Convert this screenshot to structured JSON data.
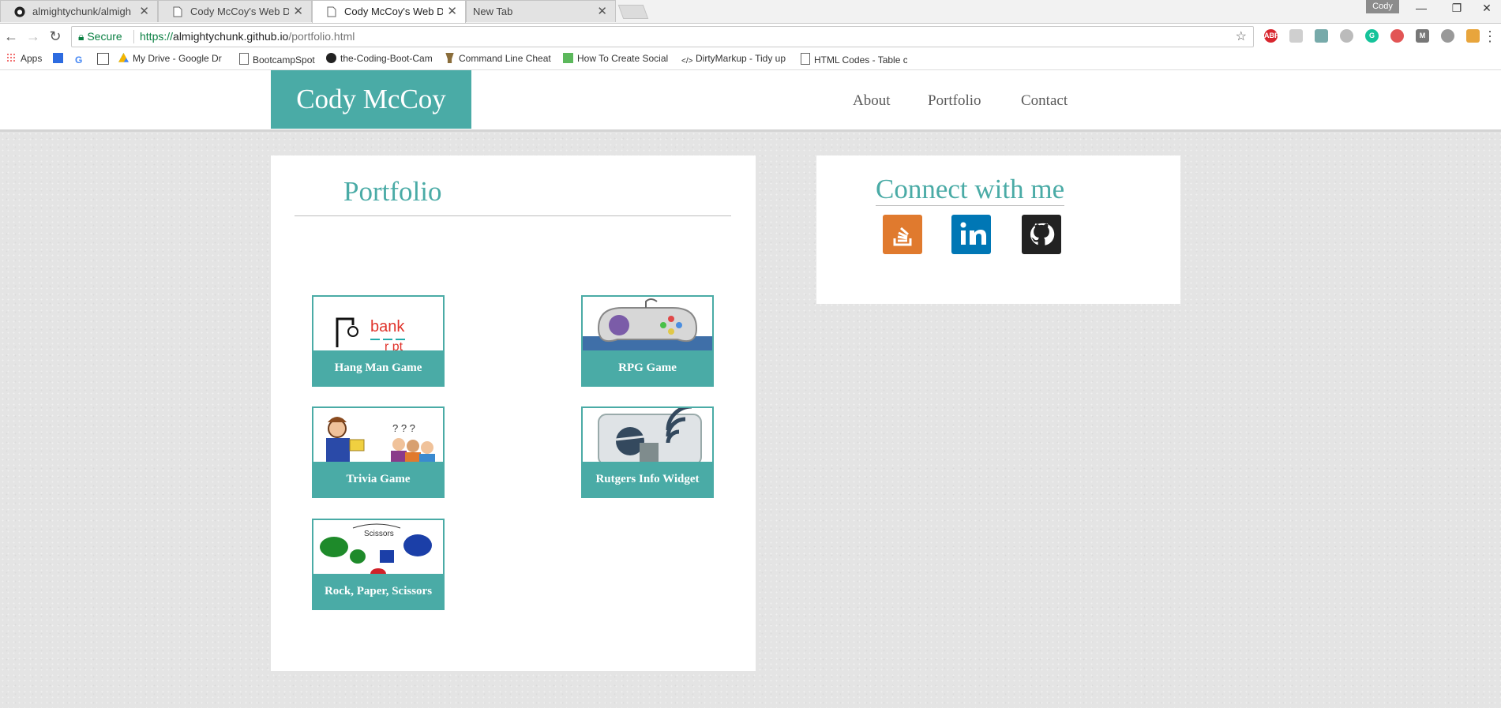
{
  "browser": {
    "tabs": [
      {
        "label": "almightychunk/almighty",
        "active": false
      },
      {
        "label": "Cody McCoy's Web Deve",
        "active": false
      },
      {
        "label": "Cody McCoy's Web Deve",
        "active": true
      },
      {
        "label": "New Tab",
        "active": false
      }
    ],
    "profile_name": "Cody",
    "secure_label": "Secure",
    "url_scheme": "https://",
    "url_host": "almightychunk.github.io",
    "url_path": "/portfolio.html",
    "bookmarks": [
      {
        "label": "Apps",
        "icon": "apps-grid-icon"
      },
      {
        "label": "",
        "icon": "calendar-icon"
      },
      {
        "label": "",
        "icon": "google-icon"
      },
      {
        "label": "",
        "icon": "reading-list-icon"
      },
      {
        "label": "My Drive - Google Dr",
        "icon": "drive-icon"
      },
      {
        "label": "BootcampSpot",
        "icon": "page-icon"
      },
      {
        "label": "the-Coding-Boot-Cam",
        "icon": "github-icon"
      },
      {
        "label": "Command Line Cheat",
        "icon": "trophy-icon"
      },
      {
        "label": "How To Create Social",
        "icon": "image-icon"
      },
      {
        "label": "DirtyMarkup - Tidy up",
        "icon": "code-icon"
      },
      {
        "label": "HTML Codes - Table c",
        "icon": "page-icon"
      }
    ]
  },
  "site": {
    "brand": "Cody McCoy",
    "nav": [
      "About",
      "Portfolio",
      "Contact"
    ]
  },
  "portfolio": {
    "title": "Portfolio",
    "items": [
      {
        "caption": "Hang Man Game",
        "thumb": "hangman-thumb"
      },
      {
        "caption": "RPG Game",
        "thumb": "gamepad-thumb"
      },
      {
        "caption": "Trivia Game",
        "thumb": "trivia-thumb"
      },
      {
        "caption": "Rutgers Info Widget",
        "thumb": "widget-thumb"
      },
      {
        "caption": "Rock, Paper, Scissors",
        "thumb": "rps-thumb"
      }
    ],
    "thumb_text": {
      "hangman": "bank",
      "rps_top": "Scissors"
    }
  },
  "connect": {
    "title": "Connect with me",
    "links": [
      {
        "icon": "stackoverflow-icon",
        "color": "#e07a2e"
      },
      {
        "icon": "linkedin-icon",
        "color": "#0077b5"
      },
      {
        "icon": "github-icon",
        "color": "#222222"
      }
    ]
  },
  "colors": {
    "accent": "#4aaba6",
    "nav_text": "#5a5a5a",
    "page_bg": "#e4e4e4"
  }
}
